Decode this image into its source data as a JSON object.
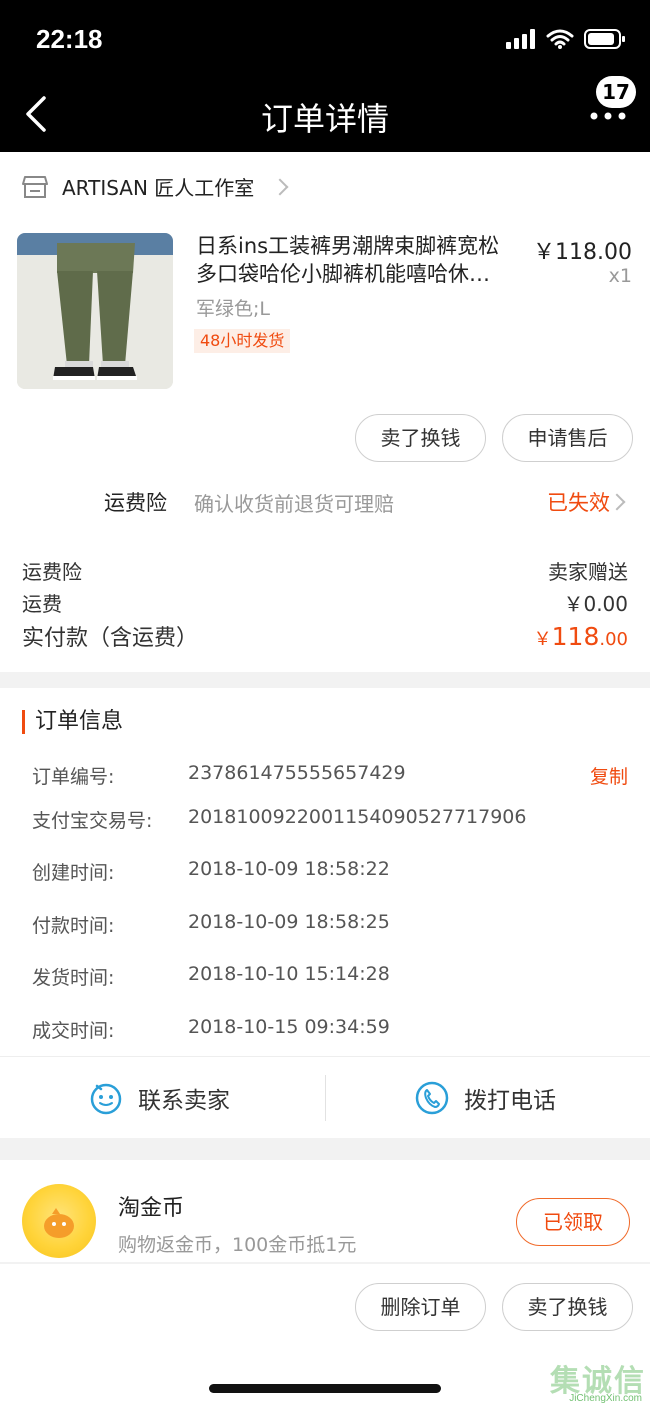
{
  "status_bar": {
    "time": "22:18"
  },
  "nav": {
    "title": "订单详情",
    "badge_count": "17"
  },
  "shop": {
    "name": "ARTISAN 匠人工作室"
  },
  "product": {
    "title_line1": "日系ins工装裤男潮牌束脚裤宽松",
    "title_line2": "多口袋哈伦小脚裤机能嘻哈休…",
    "price": "￥118.00",
    "qty": "x1",
    "sku": "军绿色;L",
    "ship_tag": "48小时发货"
  },
  "product_actions": {
    "sell_label": "卖了换钱",
    "aftersale_label": "申请售后"
  },
  "insurance": {
    "label": "运费险",
    "desc": "确认收货前退货可理赔",
    "status": "已失效"
  },
  "fees": {
    "insurance_label": "运费险",
    "insurance_value": "卖家赠送",
    "shipping_label": "运费",
    "shipping_value": "￥0.00",
    "total_label": "实付款（含运费）",
    "total_currency": "￥",
    "total_int": "118",
    "total_dec": ".00"
  },
  "order_info": {
    "title": "订单信息",
    "copy_label": "复制",
    "rows": [
      {
        "label": "订单编号:",
        "value": "237861475555657429"
      },
      {
        "label": "支付宝交易号:",
        "value": "2018100922001154090527717906"
      },
      {
        "label": "创建时间:",
        "value": "2018-10-09 18:58:22"
      },
      {
        "label": "付款时间:",
        "value": "2018-10-09 18:58:25"
      },
      {
        "label": "发货时间:",
        "value": "2018-10-10 15:14:28"
      },
      {
        "label": "成交时间:",
        "value": "2018-10-15 09:34:59"
      }
    ]
  },
  "contact": {
    "seller_label": "联系卖家",
    "phone_label": "拨打电话"
  },
  "coins": {
    "title": "淘金币",
    "subtitle": "购物返金币，100金币抵1元",
    "claimed_label": "已领取"
  },
  "bottom_actions": {
    "delete_label": "删除订单",
    "sell_label": "卖了换钱"
  },
  "watermark": {
    "text": "集诚信",
    "url": "JiChengXin.com"
  },
  "colors": {
    "accent": "#f04b10",
    "link_blue": "#2a9fd8"
  }
}
